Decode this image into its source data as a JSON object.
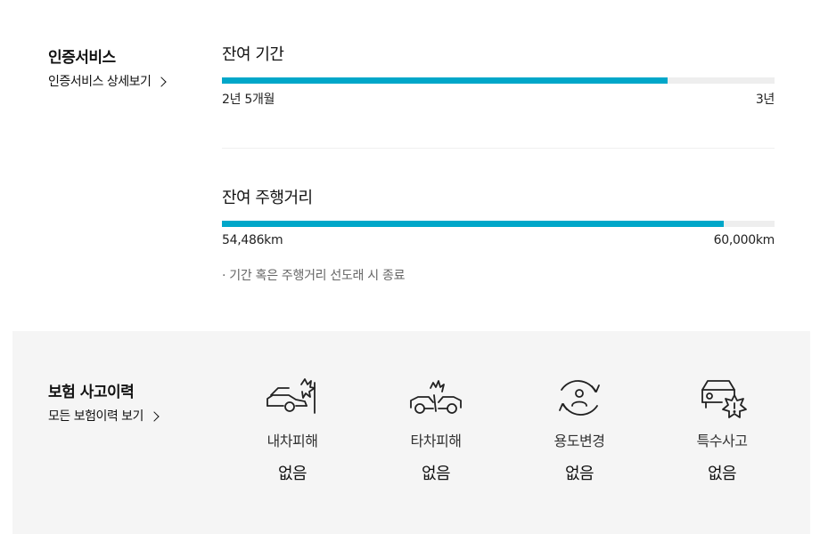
{
  "cert": {
    "title": "인증서비스",
    "link": "인증서비스 상세보기"
  },
  "period": {
    "label": "잔여 기간",
    "current": "2년 5개월",
    "max": "3년",
    "fill_fraction": 0.806
  },
  "mileage": {
    "label": "잔여 주행거리",
    "current": "54,486km",
    "max": "60,000km",
    "fill_fraction": 0.908
  },
  "note": "·  기간 혹은 주행거리 선도래 시 종료",
  "insurance": {
    "title": "보험 사고이력",
    "link": "모든 보험이력 보기",
    "items": [
      {
        "label": "내차피해",
        "value": "없음",
        "icon": "own-car-damage-icon"
      },
      {
        "label": "타차피해",
        "value": "없음",
        "icon": "other-car-damage-icon"
      },
      {
        "label": "용도변경",
        "value": "없음",
        "icon": "usage-change-icon"
      },
      {
        "label": "특수사고",
        "value": "없음",
        "icon": "special-accident-icon"
      }
    ]
  },
  "colors": {
    "accent": "#00a7c9",
    "track": "#eeeeee",
    "panel": "#f5f5f5"
  }
}
